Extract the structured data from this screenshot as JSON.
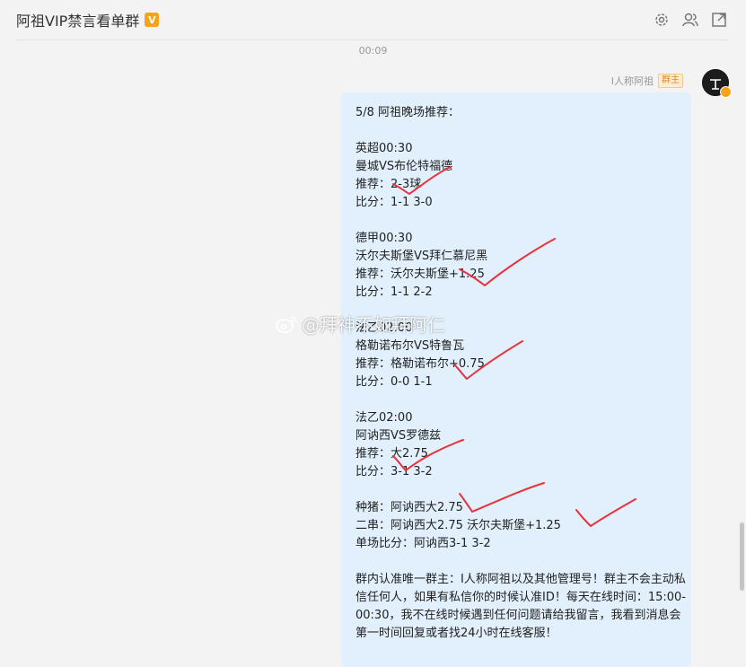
{
  "header": {
    "title": "阿祖VIP禁言看单群",
    "badge": "V",
    "icons": [
      "gear-icon",
      "members-icon",
      "popout-icon"
    ]
  },
  "timestamp": "00:09",
  "message": {
    "sender_name": "I人称阿祖",
    "sender_role": "群主",
    "text": "5/8 阿祖晚场推荐：\n\n英超00:30\n曼城VS布伦特福德\n推荐：2-3球\n比分：1-1 3-0\n\n德甲00:30\n沃尔夫斯堡VS拜仁慕尼黑\n推荐：沃尔夫斯堡+1.25\n比分：1-1 2-2\n\n法乙02:00\n格勒诺布尔VS特鲁瓦\n推荐：格勒诺布尔+0.75\n比分：0-0 1-1\n\n法乙02:00\n阿讷西VS罗德兹\n推荐：大2.75\n比分：3-1 3-2\n\n种猪：阿讷西大2.75\n二串：阿讷西大2.75 沃尔夫斯堡+1.25\n单场比分：阿讷西3-1 3-2\n\n群内认准唯一群主：I人称阿祖以及其他管理号！群主不会主动私信任何人，如果有私信你的时候认准ID！每天在线时间：15:00-00:30，我不在线时候遇到任何问题请给我留言，我看到消息会第一时间回复或者找24小时在线客服！"
  },
  "watermark": "@拜神不如拜阿仁",
  "colors": {
    "bubble": "#e1f0fc",
    "background": "#f3f3f3",
    "check_marks": "#e8323c",
    "vip_badge": "#f7a318"
  }
}
